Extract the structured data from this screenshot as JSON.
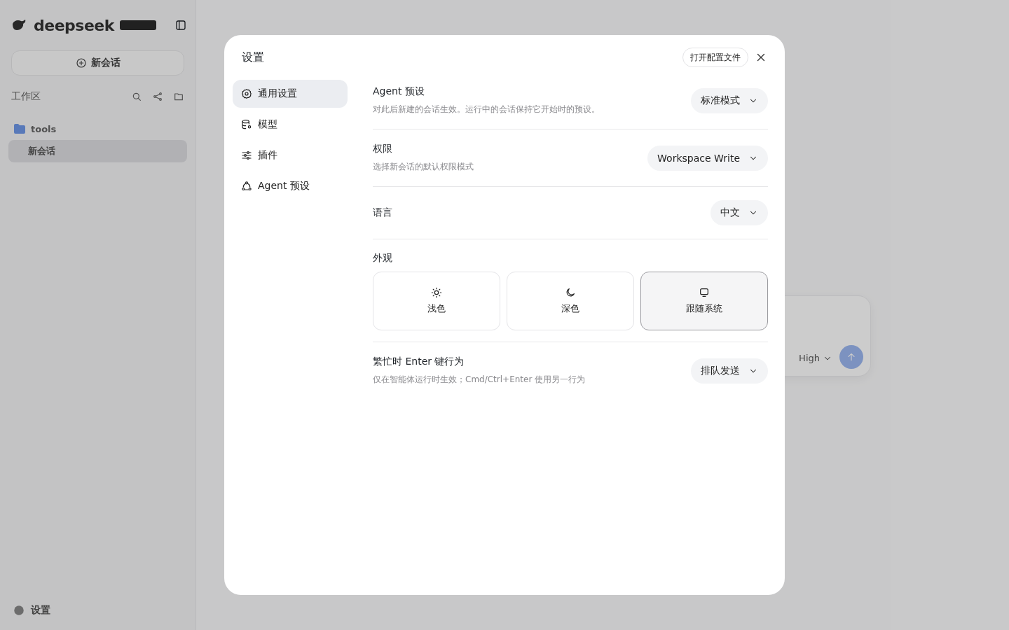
{
  "sidebar": {
    "brand": "deepseek",
    "new_chat": "新会话",
    "section": "工作区",
    "folders": [
      {
        "name": "tools",
        "children": [
          {
            "title": "新会话",
            "selected": true
          }
        ]
      }
    ],
    "footer": "设置"
  },
  "composer": {
    "effort": "High"
  },
  "dialog": {
    "title": "设置",
    "open_config": "打开配置文件",
    "nav": [
      {
        "kind": "gear",
        "label": "通用设置",
        "selected": true
      },
      {
        "kind": "model",
        "label": "模型",
        "selected": false
      },
      {
        "kind": "sliders",
        "label": "插件",
        "selected": false
      },
      {
        "kind": "agent",
        "label": "Agent 预设",
        "selected": false
      }
    ],
    "settings": [
      {
        "kind": "select",
        "label": "Agent 预设",
        "description": "对此后新建的会话生效。运行中的会话保持它开始时的预设。",
        "value": "标准模式"
      },
      {
        "kind": "select",
        "label": "权限",
        "description": "选择新会话的默认权限模式",
        "value": "Workspace Write"
      },
      {
        "kind": "select",
        "label": "语言",
        "value": "中文"
      },
      {
        "kind": "appearance",
        "label": "外观",
        "options": [
          {
            "kind": "sun",
            "label": "浅色",
            "selected": false
          },
          {
            "kind": "moon",
            "label": "深色",
            "selected": false
          },
          {
            "kind": "monitor",
            "label": "跟随系统",
            "selected": true
          }
        ]
      },
      {
        "kind": "select",
        "label": "繁忙时 Enter 键行为",
        "description": "仅在智能体运行时生效；Cmd/Ctrl+Enter 使用另一行为",
        "value": "排队发送"
      }
    ]
  }
}
